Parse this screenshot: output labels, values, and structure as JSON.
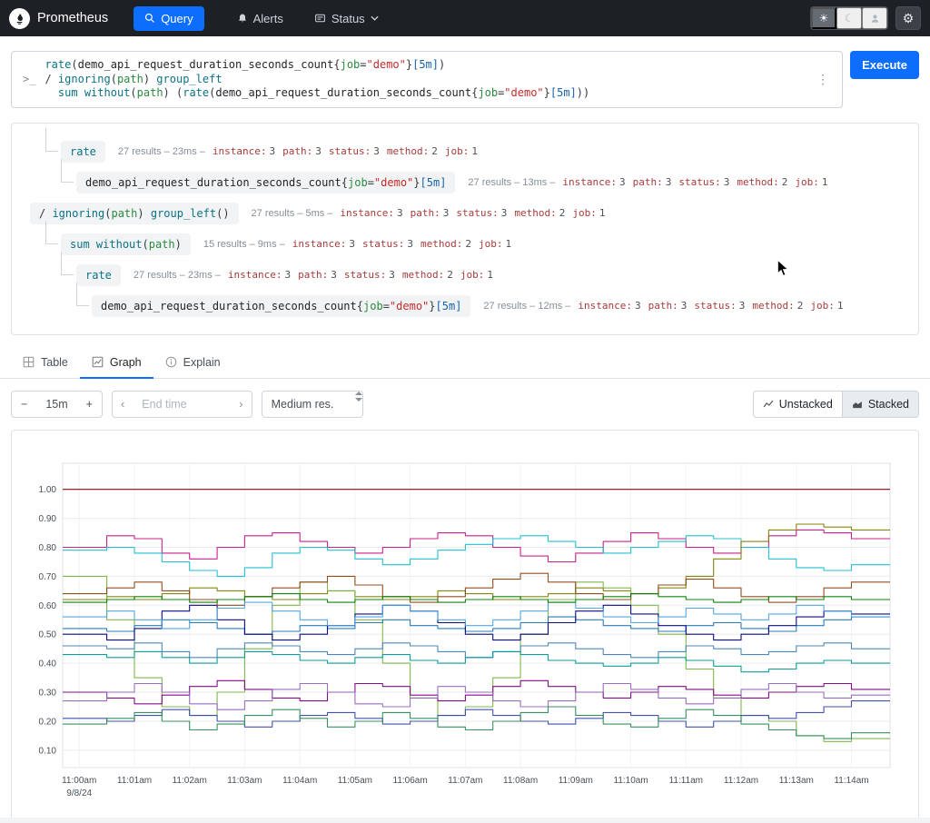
{
  "colors": {
    "accent": "#0d6efd",
    "navbar_bg": "#1d2126"
  },
  "icons": {
    "sun": "☀",
    "moon": "☾",
    "gear": "⚙",
    "kebab": "⋮",
    "chevron_left": "‹",
    "chevron_right": "›"
  },
  "navbar": {
    "brand": "Prometheus",
    "query_label": "Query",
    "alerts_label": "Alerts",
    "status_label": "Status"
  },
  "editor": {
    "prompt": ">_",
    "execute_label": "Execute",
    "code_lines": [
      [
        [
          "fn",
          "rate"
        ],
        [
          "p",
          "("
        ],
        [
          "m",
          "demo_api_request_duration_seconds_count"
        ],
        [
          "p",
          "{"
        ],
        [
          "lbl",
          "job"
        ],
        [
          "p",
          "="
        ],
        [
          "str",
          "\"demo\""
        ],
        [
          "p",
          "}"
        ],
        [
          "dur",
          "[5m]"
        ],
        [
          "p",
          ")"
        ]
      ],
      [
        [
          "p",
          "/ "
        ],
        [
          "kw",
          "ignoring"
        ],
        [
          "p",
          "("
        ],
        [
          "lbl",
          "path"
        ],
        [
          "p",
          ") "
        ],
        [
          "kw",
          "group_left"
        ]
      ],
      [
        [
          "p",
          "  "
        ],
        [
          "kw",
          "sum"
        ],
        [
          "p",
          " "
        ],
        [
          "kw",
          "without"
        ],
        [
          "p",
          "("
        ],
        [
          "lbl",
          "path"
        ],
        [
          "p",
          ") ("
        ],
        [
          "fn",
          "rate"
        ],
        [
          "p",
          "("
        ],
        [
          "m",
          "demo_api_request_duration_seconds_count"
        ],
        [
          "p",
          "{"
        ],
        [
          "lbl",
          "job"
        ],
        [
          "p",
          "="
        ],
        [
          "str",
          "\"demo\""
        ],
        [
          "p",
          "}"
        ],
        [
          "dur",
          "[5m]"
        ],
        [
          "p",
          "))"
        ]
      ]
    ]
  },
  "tree": {
    "rows": [
      {
        "level": 1,
        "tokens": [
          [
            "fn",
            "rate"
          ]
        ],
        "stats": {
          "results": "27 results",
          "time": "23ms",
          "labels": [
            [
              "instance",
              "3"
            ],
            [
              "path",
              "3"
            ],
            [
              "status",
              "3"
            ],
            [
              "method",
              "2"
            ],
            [
              "job",
              "1"
            ]
          ]
        }
      },
      {
        "level": 2,
        "tokens": [
          [
            "m",
            "demo_api_request_duration_seconds_count"
          ],
          [
            "p",
            "{"
          ],
          [
            "lbl",
            "job"
          ],
          [
            "p",
            "="
          ],
          [
            "str",
            "\"demo\""
          ],
          [
            "p",
            "}"
          ],
          [
            "dur",
            "[5m]"
          ]
        ],
        "stats": {
          "results": "27 results",
          "time": "13ms",
          "labels": [
            [
              "instance",
              "3"
            ],
            [
              "path",
              "3"
            ],
            [
              "status",
              "3"
            ],
            [
              "method",
              "2"
            ],
            [
              "job",
              "1"
            ]
          ]
        }
      },
      {
        "level": 0,
        "tokens": [
          [
            "p",
            "/ "
          ],
          [
            "kw",
            "ignoring"
          ],
          [
            "p",
            "("
          ],
          [
            "lbl",
            "path"
          ],
          [
            "p",
            ") "
          ],
          [
            "kw",
            "group_left"
          ],
          [
            "p",
            "()"
          ]
        ],
        "stats": {
          "results": "27 results",
          "time": "5ms",
          "labels": [
            [
              "instance",
              "3"
            ],
            [
              "path",
              "3"
            ],
            [
              "status",
              "3"
            ],
            [
              "method",
              "2"
            ],
            [
              "job",
              "1"
            ]
          ]
        }
      },
      {
        "level": 1,
        "tokens": [
          [
            "kw",
            "sum"
          ],
          [
            "p",
            " "
          ],
          [
            "kw",
            "without"
          ],
          [
            "p",
            "("
          ],
          [
            "lbl",
            "path"
          ],
          [
            "p",
            ")"
          ]
        ],
        "stats": {
          "results": "15 results",
          "time": "9ms",
          "labels": [
            [
              "instance",
              "3"
            ],
            [
              "status",
              "3"
            ],
            [
              "method",
              "2"
            ],
            [
              "job",
              "1"
            ]
          ]
        }
      },
      {
        "level": 2,
        "tokens": [
          [
            "fn",
            "rate"
          ]
        ],
        "stats": {
          "results": "27 results",
          "time": "23ms",
          "labels": [
            [
              "instance",
              "3"
            ],
            [
              "path",
              "3"
            ],
            [
              "status",
              "3"
            ],
            [
              "method",
              "2"
            ],
            [
              "job",
              "1"
            ]
          ]
        }
      },
      {
        "level": 3,
        "tokens": [
          [
            "m",
            "demo_api_request_duration_seconds_count"
          ],
          [
            "p",
            "{"
          ],
          [
            "lbl",
            "job"
          ],
          [
            "p",
            "="
          ],
          [
            "str",
            "\"demo\""
          ],
          [
            "p",
            "}"
          ],
          [
            "dur",
            "[5m]"
          ]
        ],
        "stats": {
          "results": "27 results",
          "time": "12ms",
          "labels": [
            [
              "instance",
              "3"
            ],
            [
              "path",
              "3"
            ],
            [
              "status",
              "3"
            ],
            [
              "method",
              "2"
            ],
            [
              "job",
              "1"
            ]
          ]
        }
      }
    ]
  },
  "tabs": {
    "table": "Table",
    "graph": "Graph",
    "explain": "Explain"
  },
  "controls": {
    "minus": "−",
    "duration": "15m",
    "plus": "+",
    "end_time_placeholder": "End time",
    "resolution": "Medium res.",
    "unstacked": "Unstacked",
    "stacked": "Stacked"
  },
  "chart_data": {
    "type": "line",
    "title": "",
    "xlabel": "",
    "ylabel": "",
    "x_ticks": [
      "11:00am",
      "11:01am",
      "11:02am",
      "11:03am",
      "11:04am",
      "11:05am",
      "11:06am",
      "11:07am",
      "11:08am",
      "11:09am",
      "11:10am",
      "11:11am",
      "11:12am",
      "11:13am",
      "11:14am"
    ],
    "x_date_label": "9/8/24",
    "y_ticks": [
      "0.10",
      "0.20",
      "0.30",
      "0.40",
      "0.50",
      "0.60",
      "0.70",
      "0.80",
      "0.90",
      "1.00"
    ],
    "xlim": [
      -0.3,
      14.7
    ],
    "ylim": [
      0.04,
      1.09
    ],
    "x_start": 0,
    "x_step_minutes": 0.5,
    "grid": true,
    "legend": "none",
    "series": [
      {
        "name": "series-1",
        "color": "#800000",
        "values": [
          1.0,
          1.0,
          1.0,
          1.0,
          1.0,
          1.0,
          1.0,
          1.0,
          1.0,
          1.0,
          1.0,
          1.0,
          1.0,
          1.0,
          1.0,
          1.0,
          1.0,
          1.0,
          1.0,
          1.0,
          1.0,
          1.0,
          1.0,
          1.0,
          1.0,
          1.0,
          1.0,
          1.0,
          1.0
        ]
      },
      {
        "name": "series-2",
        "color": "#c71585",
        "values": [
          0.8,
          0.84,
          0.83,
          0.78,
          0.76,
          0.8,
          0.84,
          0.85,
          0.82,
          0.8,
          0.78,
          0.8,
          0.83,
          0.85,
          0.84,
          0.8,
          0.77,
          0.75,
          0.78,
          0.82,
          0.85,
          0.83,
          0.8,
          0.78,
          0.8,
          0.84,
          0.86,
          0.85,
          0.83
        ]
      },
      {
        "name": "series-3",
        "color": "#17becf",
        "values": [
          0.79,
          0.8,
          0.78,
          0.75,
          0.72,
          0.7,
          0.73,
          0.78,
          0.8,
          0.79,
          0.76,
          0.74,
          0.76,
          0.79,
          0.81,
          0.83,
          0.84,
          0.82,
          0.8,
          0.78,
          0.8,
          0.82,
          0.84,
          0.83,
          0.8,
          0.76,
          0.73,
          0.72,
          0.74
        ]
      },
      {
        "name": "series-4",
        "color": "#808000",
        "values": [
          0.62,
          0.63,
          0.62,
          0.64,
          0.66,
          0.65,
          0.63,
          0.62,
          0.64,
          0.65,
          0.63,
          0.62,
          0.63,
          0.65,
          0.64,
          0.62,
          0.63,
          0.64,
          0.66,
          0.65,
          0.64,
          0.66,
          0.7,
          0.76,
          0.82,
          0.86,
          0.88,
          0.87,
          0.86
        ]
      },
      {
        "name": "series-5",
        "color": "#7cb342",
        "values": [
          0.7,
          0.55,
          0.35,
          0.25,
          0.22,
          0.3,
          0.45,
          0.6,
          0.68,
          0.65,
          0.55,
          0.4,
          0.28,
          0.22,
          0.25,
          0.35,
          0.5,
          0.62,
          0.68,
          0.66,
          0.6,
          0.5,
          0.38,
          0.28,
          0.22,
          0.2,
          0.15,
          0.13,
          0.14
        ]
      },
      {
        "name": "series-6",
        "color": "#1f77b4",
        "values": [
          0.52,
          0.51,
          0.53,
          0.55,
          0.54,
          0.52,
          0.5,
          0.51,
          0.53,
          0.52,
          0.54,
          0.55,
          0.53,
          0.52,
          0.51,
          0.52,
          0.54,
          0.56,
          0.55,
          0.53,
          0.52,
          0.51,
          0.53,
          0.54,
          0.52,
          0.51,
          0.53,
          0.55,
          0.56
        ]
      },
      {
        "name": "series-7",
        "color": "#000080",
        "values": [
          0.5,
          0.48,
          0.52,
          0.58,
          0.6,
          0.55,
          0.5,
          0.48,
          0.5,
          0.53,
          0.57,
          0.6,
          0.58,
          0.54,
          0.5,
          0.48,
          0.5,
          0.54,
          0.58,
          0.6,
          0.57,
          0.53,
          0.5,
          0.48,
          0.5,
          0.53,
          0.56,
          0.58,
          0.57
        ]
      },
      {
        "name": "series-8",
        "color": "#4682b4",
        "values": [
          0.46,
          0.45,
          0.47,
          0.44,
          0.42,
          0.45,
          0.47,
          0.46,
          0.44,
          0.43,
          0.45,
          0.47,
          0.46,
          0.44,
          0.42,
          0.44,
          0.46,
          0.47,
          0.45,
          0.43,
          0.42,
          0.44,
          0.46,
          0.45,
          0.43,
          0.44,
          0.46,
          0.47,
          0.45
        ]
      },
      {
        "name": "series-9",
        "color": "#009999",
        "values": [
          0.43,
          0.42,
          0.44,
          0.42,
          0.4,
          0.42,
          0.44,
          0.43,
          0.41,
          0.4,
          0.42,
          0.43,
          0.41,
          0.4,
          0.42,
          0.44,
          0.43,
          0.41,
          0.4,
          0.39,
          0.4,
          0.42,
          0.41,
          0.39,
          0.37,
          0.38,
          0.4,
          0.41,
          0.4
        ]
      },
      {
        "name": "series-10",
        "color": "#800080",
        "values": [
          0.3,
          0.28,
          0.26,
          0.29,
          0.32,
          0.34,
          0.31,
          0.28,
          0.27,
          0.3,
          0.33,
          0.32,
          0.29,
          0.27,
          0.29,
          0.32,
          0.34,
          0.32,
          0.3,
          0.28,
          0.3,
          0.32,
          0.31,
          0.29,
          0.28,
          0.3,
          0.32,
          0.33,
          0.31
        ]
      },
      {
        "name": "series-11",
        "color": "#9467bd",
        "values": [
          0.27,
          0.3,
          0.33,
          0.3,
          0.26,
          0.24,
          0.27,
          0.31,
          0.33,
          0.3,
          0.26,
          0.25,
          0.28,
          0.32,
          0.3,
          0.27,
          0.25,
          0.27,
          0.3,
          0.33,
          0.31,
          0.28,
          0.26,
          0.28,
          0.31,
          0.33,
          0.3,
          0.28,
          0.29
        ]
      },
      {
        "name": "series-12",
        "color": "#3949ab",
        "values": [
          0.21,
          0.2,
          0.22,
          0.24,
          0.22,
          0.2,
          0.18,
          0.2,
          0.22,
          0.23,
          0.21,
          0.19,
          0.2,
          0.22,
          0.24,
          0.22,
          0.2,
          0.19,
          0.21,
          0.23,
          0.22,
          0.2,
          0.18,
          0.2,
          0.22,
          0.21,
          0.23,
          0.25,
          0.27
        ]
      },
      {
        "name": "series-13",
        "color": "#2e8b57",
        "values": [
          0.19,
          0.21,
          0.23,
          0.2,
          0.17,
          0.19,
          0.22,
          0.24,
          0.21,
          0.18,
          0.2,
          0.23,
          0.21,
          0.18,
          0.17,
          0.2,
          0.23,
          0.25,
          0.22,
          0.19,
          0.18,
          0.21,
          0.24,
          0.22,
          0.19,
          0.17,
          0.15,
          0.14,
          0.16
        ]
      },
      {
        "name": "series-14",
        "color": "#8b4513",
        "values": [
          0.64,
          0.66,
          0.68,
          0.65,
          0.62,
          0.6,
          0.63,
          0.66,
          0.68,
          0.7,
          0.67,
          0.63,
          0.61,
          0.63,
          0.66,
          0.69,
          0.71,
          0.68,
          0.64,
          0.62,
          0.64,
          0.67,
          0.69,
          0.66,
          0.63,
          0.61,
          0.63,
          0.66,
          0.68
        ]
      },
      {
        "name": "series-15",
        "color": "#4aa3df",
        "values": [
          0.56,
          0.58,
          0.55,
          0.52,
          0.55,
          0.59,
          0.61,
          0.58,
          0.55,
          0.53,
          0.56,
          0.6,
          0.58,
          0.55,
          0.53,
          0.55,
          0.58,
          0.61,
          0.59,
          0.56,
          0.54,
          0.56,
          0.59,
          0.57,
          0.55,
          0.57,
          0.6,
          0.58,
          0.56
        ]
      },
      {
        "name": "series-16",
        "color": "#008000",
        "values": [
          0.61,
          0.62,
          0.63,
          0.62,
          0.61,
          0.62,
          0.63,
          0.64,
          0.62,
          0.61,
          0.62,
          0.63,
          0.62,
          0.61,
          0.62,
          0.63,
          0.62,
          0.61,
          0.62,
          0.63,
          0.64,
          0.63,
          0.62,
          0.61,
          0.62,
          0.63,
          0.62,
          0.63,
          0.62
        ]
      }
    ]
  }
}
